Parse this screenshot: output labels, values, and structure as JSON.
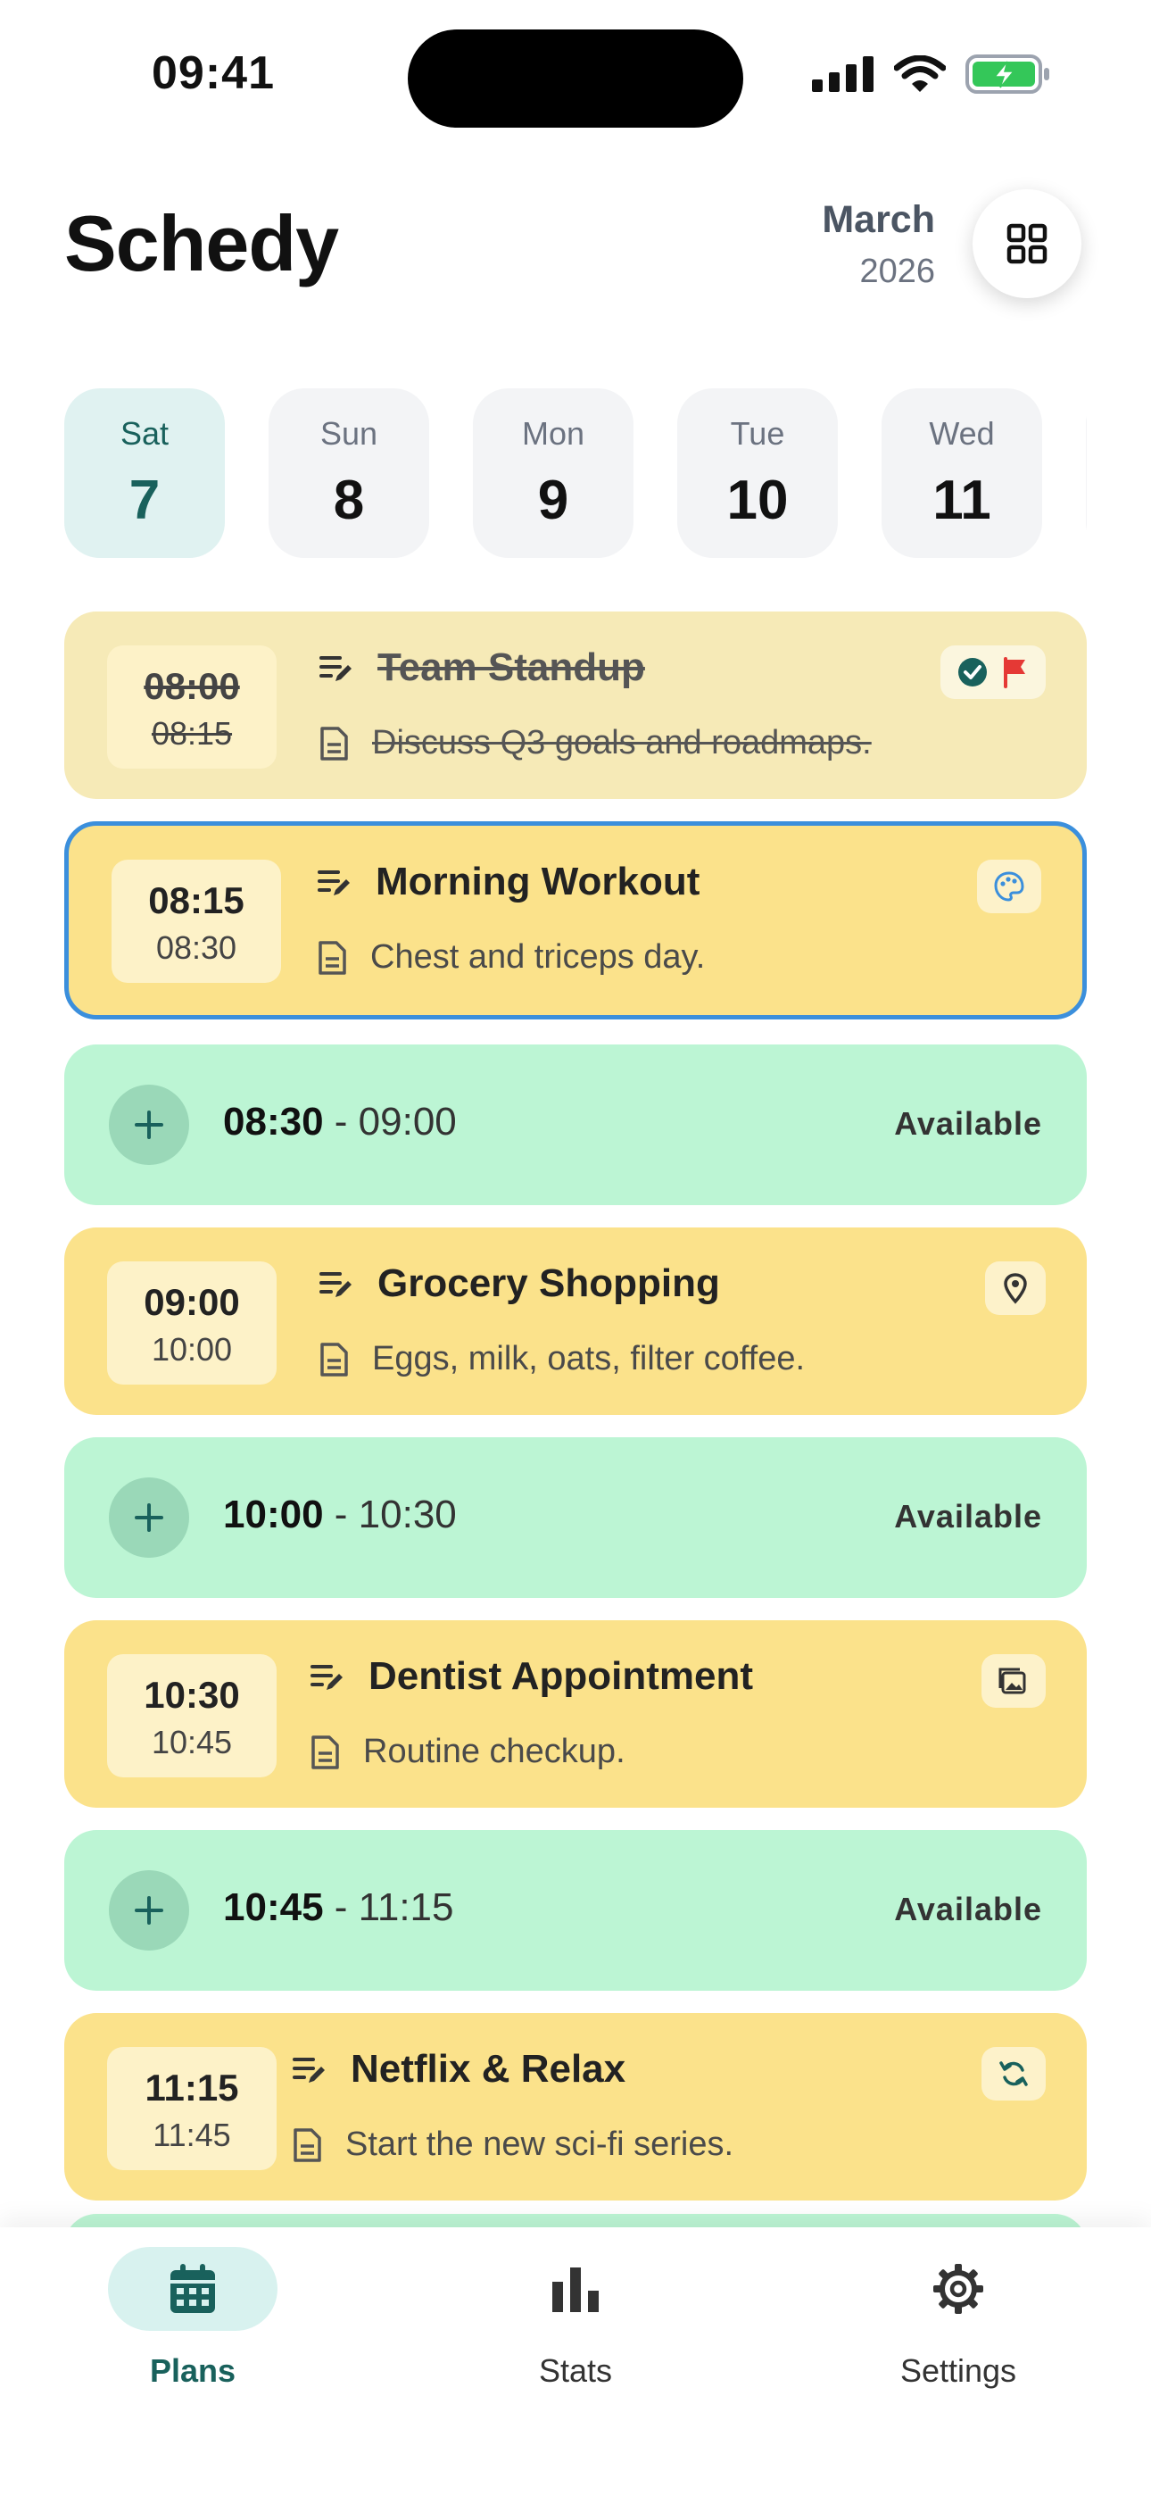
{
  "status_bar": {
    "time": "09:41"
  },
  "header": {
    "title": "Schedy",
    "month": "March",
    "year": "2026"
  },
  "days": [
    {
      "name": "Sat",
      "date": "7",
      "active": true
    },
    {
      "name": "Sun",
      "date": "8",
      "active": false
    },
    {
      "name": "Mon",
      "date": "9",
      "active": false
    },
    {
      "name": "Tue",
      "date": "10",
      "active": false
    },
    {
      "name": "Wed",
      "date": "11",
      "active": false
    }
  ],
  "events": {
    "e1": {
      "start": "08:00",
      "end": "08:15",
      "title": "Team Standup",
      "desc": "Discuss Q3 goals and roadmaps.",
      "status": "completed",
      "badges": [
        "check-circle-icon",
        "flag-icon"
      ]
    },
    "e2": {
      "start": "08:15",
      "end": "08:30",
      "title": "Morning Workout",
      "desc": "Chest and triceps day.",
      "status": "selected",
      "badges": [
        "palette-icon"
      ]
    },
    "e3": {
      "start": "09:00",
      "end": "10:00",
      "title": "Grocery Shopping",
      "desc": "Eggs, milk, oats, filter coffee.",
      "badges": [
        "location-pin-icon"
      ]
    },
    "e4": {
      "start": "10:30",
      "end": "10:45",
      "title": "Dentist Appointment",
      "desc": "Routine checkup.",
      "badges": [
        "image-icon"
      ]
    },
    "e5": {
      "start": "11:15",
      "end": "11:45",
      "title": "Netflix & Relax",
      "desc": "Start the new sci-fi series.",
      "badges": [
        "repeat-icon"
      ]
    }
  },
  "slots": {
    "s1": {
      "start": "08:30",
      "end": "- 09:00",
      "label": "Available"
    },
    "s2": {
      "start": "10:00",
      "end": "- 10:30",
      "label": "Available"
    },
    "s3": {
      "start": "10:45",
      "end": "- 11:15",
      "label": "Available"
    }
  },
  "nav": {
    "plans": "Plans",
    "stats": "Stats",
    "settings": "Settings",
    "active": "plans"
  },
  "colors": {
    "accent": "#19615c",
    "event_bg": "#fbe28b",
    "event_done_bg": "#f6eab7",
    "available_bg": "#bcf5d4",
    "selected_border": "#3b8fdc",
    "flag": "#e53935"
  }
}
